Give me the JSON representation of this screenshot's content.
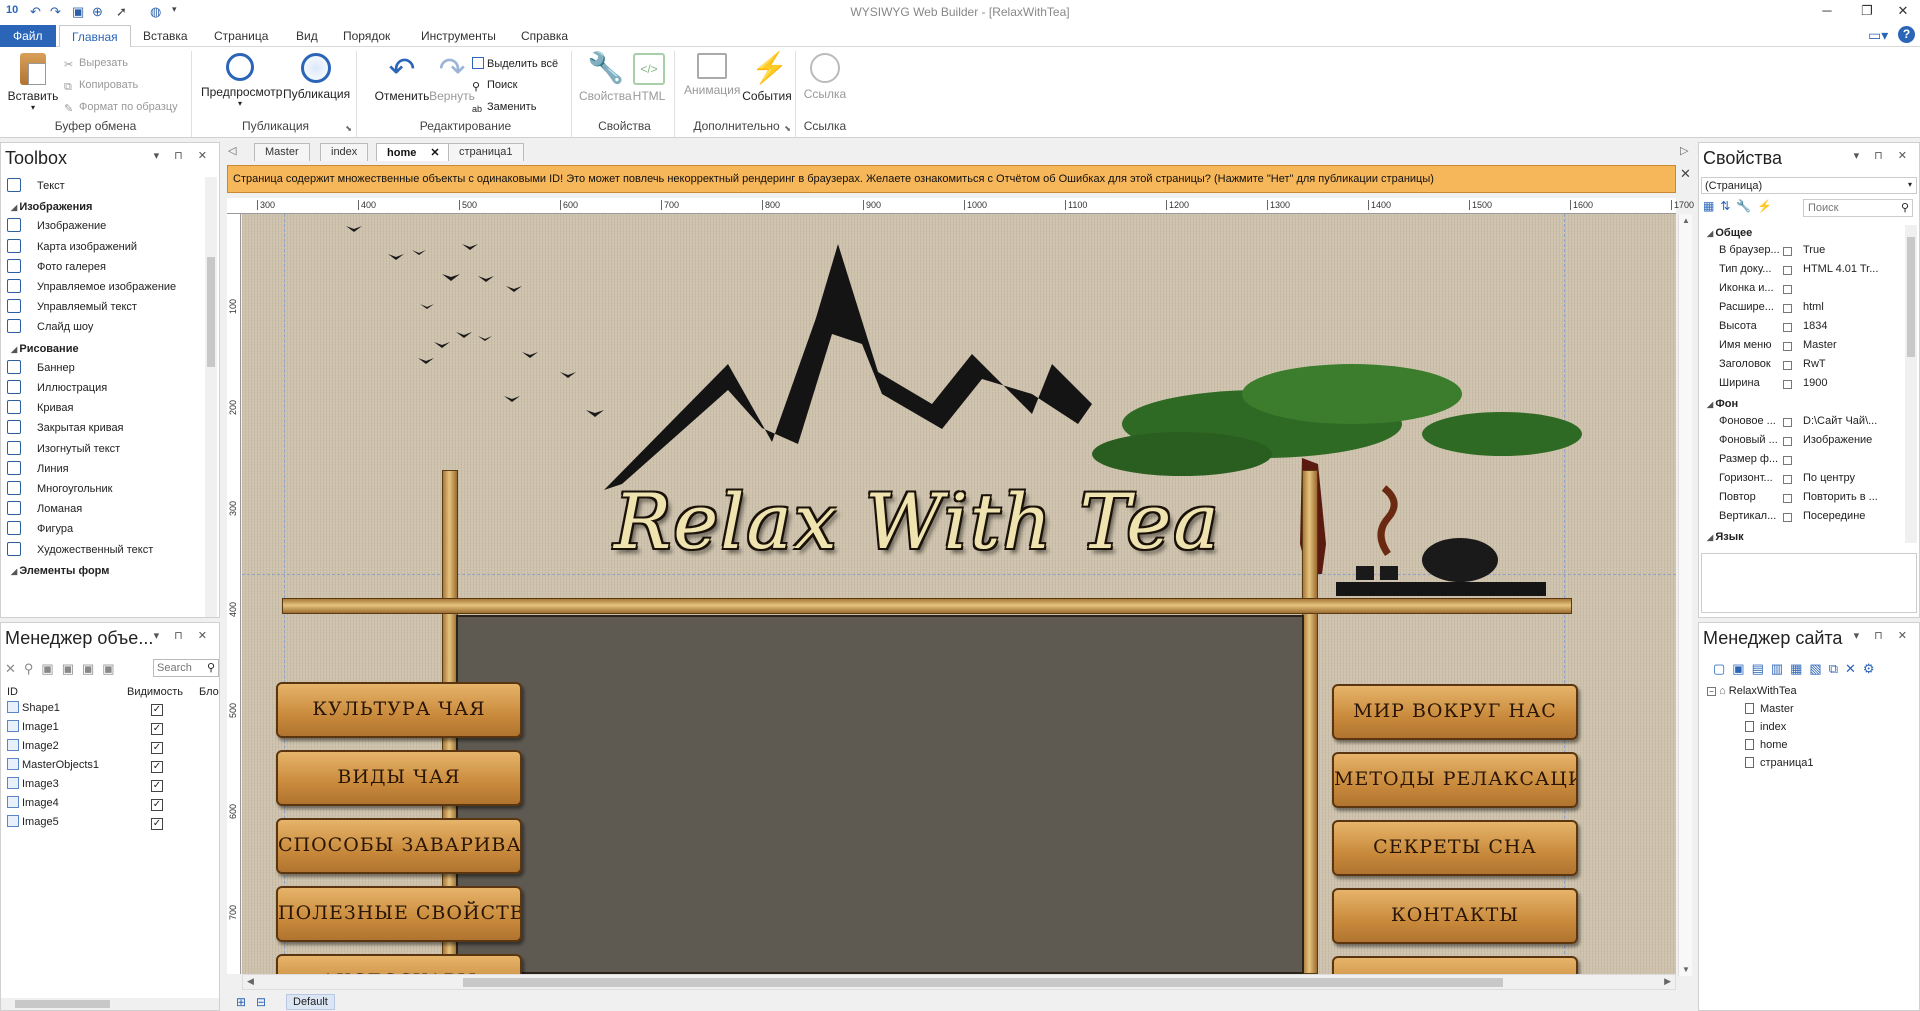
{
  "window": {
    "title": "WYSIWYG Web Builder - [RelaxWithTea]",
    "app_version": "10"
  },
  "menu": {
    "items": [
      "Файл",
      "Главная",
      "Вставка",
      "Страница",
      "Вид",
      "Порядок",
      "Инструменты",
      "Справка"
    ]
  },
  "ribbon": {
    "clipboard": {
      "label": "Буфер обмена",
      "paste": "Вставить",
      "cut": "Вырезать",
      "copy": "Копировать",
      "format": "Формат по образцу"
    },
    "publish": {
      "label": "Публикация",
      "preview": "Предпросмотр",
      "publish": "Публикация"
    },
    "edit": {
      "label": "Редактирование",
      "undo": "Отменить",
      "redo": "Вернуть",
      "select_all": "Выделить всё",
      "find": "Поиск",
      "replace": "Заменить"
    },
    "props": {
      "label": "Свойства",
      "properties": "Свойства",
      "html": "HTML"
    },
    "extra": {
      "label": "Дополнительно",
      "animation": "Анимация",
      "events": "События"
    },
    "link": {
      "label": "Ссылка",
      "link": "Ссылка"
    }
  },
  "toolbox": {
    "title": "Toolbox",
    "items": [
      {
        "type": "item",
        "label": "Текст"
      },
      {
        "type": "cat",
        "label": "Изображения"
      },
      {
        "type": "item",
        "label": "Изображение"
      },
      {
        "type": "item",
        "label": "Карта изображений"
      },
      {
        "type": "item",
        "label": "Фото галерея"
      },
      {
        "type": "item",
        "label": "Управляемое изображение"
      },
      {
        "type": "item",
        "label": "Управляемый текст"
      },
      {
        "type": "item",
        "label": "Слайд шоу"
      },
      {
        "type": "cat",
        "label": "Рисование"
      },
      {
        "type": "item",
        "label": "Баннер"
      },
      {
        "type": "item",
        "label": "Иллюстрация"
      },
      {
        "type": "item",
        "label": "Кривая"
      },
      {
        "type": "item",
        "label": "Закрытая кривая"
      },
      {
        "type": "item",
        "label": "Изогнутый текст"
      },
      {
        "type": "item",
        "label": "Линия"
      },
      {
        "type": "item",
        "label": "Многоугольник"
      },
      {
        "type": "item",
        "label": "Ломаная"
      },
      {
        "type": "item",
        "label": "Фигура"
      },
      {
        "type": "item",
        "label": "Художественный текст"
      },
      {
        "type": "cat",
        "label": "Элементы форм"
      }
    ]
  },
  "object_manager": {
    "title": "Менеджер объе...",
    "search_placeholder": "Search",
    "columns": [
      "ID",
      "Видимость",
      "Бло"
    ],
    "rows": [
      "Shape1",
      "Image1",
      "Image2",
      "MasterObjects1",
      "Image3",
      "Image4",
      "Image5"
    ]
  },
  "tabs": [
    "Master",
    "index",
    "home",
    "страница1"
  ],
  "warning": "Страница содержит множественные объекты с одинаковыми ID! Это может повлечь некорректный рендеринг в браузерах.  Желаете ознакомиться с Отчётом об Ошибках для этой страницы? (Нажмите \"Нет\" для публикации страницы)",
  "ruler": {
    "top": [
      "300",
      "400",
      "500",
      "600",
      "700",
      "800",
      "900",
      "1000",
      "1100",
      "1200",
      "1300",
      "1400",
      "1500",
      "1600",
      "1700"
    ],
    "left": [
      "100",
      "200",
      "300",
      "400",
      "500",
      "600",
      "700"
    ]
  },
  "site": {
    "logo": "Relax With Tea",
    "left_signs": [
      "КУЛЬТУРА ЧАЯ",
      "ВИДЫ ЧАЯ",
      "СПОСОБЫ ЗАВАРИВАНИЯ",
      "ПОЛЕЗНЫЕ СВОЙСТВА",
      "АКСЕССУАРЫ"
    ],
    "right_signs": [
      "МИР ВОКРУГ НАС",
      "МЕТОДЫ РЕЛАКСАЦИИ",
      "СЕКРЕТЫ СНА",
      "КОНТАКТЫ",
      "О НАС"
    ]
  },
  "status": {
    "layer": "Default"
  },
  "properties": {
    "title": "Свойства",
    "selector": "(Страница)",
    "search_placeholder": "Поиск",
    "general_cat": "Общее",
    "general": [
      {
        "k": "В браузер...",
        "v": "True"
      },
      {
        "k": "Тип доку...",
        "v": "HTML 4.01 Tr..."
      },
      {
        "k": "Иконка и...",
        "v": ""
      },
      {
        "k": "Расшире...",
        "v": "html"
      },
      {
        "k": "Высота",
        "v": "1834"
      },
      {
        "k": "Имя меню",
        "v": "Master"
      },
      {
        "k": "Заголовок",
        "v": "RwT"
      },
      {
        "k": "Ширина",
        "v": "1900"
      }
    ],
    "bg_cat": "Фон",
    "bg": [
      {
        "k": "Фоновое ...",
        "v": "D:\\Сайт Чай\\..."
      },
      {
        "k": "Фоновый ...",
        "v": "Изображение"
      },
      {
        "k": "Размер ф...",
        "v": ""
      },
      {
        "k": "Горизонт...",
        "v": "По центру"
      },
      {
        "k": "Повтор",
        "v": "Повторить в ..."
      },
      {
        "k": "Вертикал...",
        "v": "Посередине"
      }
    ],
    "lang_cat": "Язык"
  },
  "site_manager": {
    "title": "Менеджер сайта",
    "root": "RelaxWithTea",
    "pages": [
      "Master",
      "index",
      "home",
      "страница1"
    ]
  }
}
